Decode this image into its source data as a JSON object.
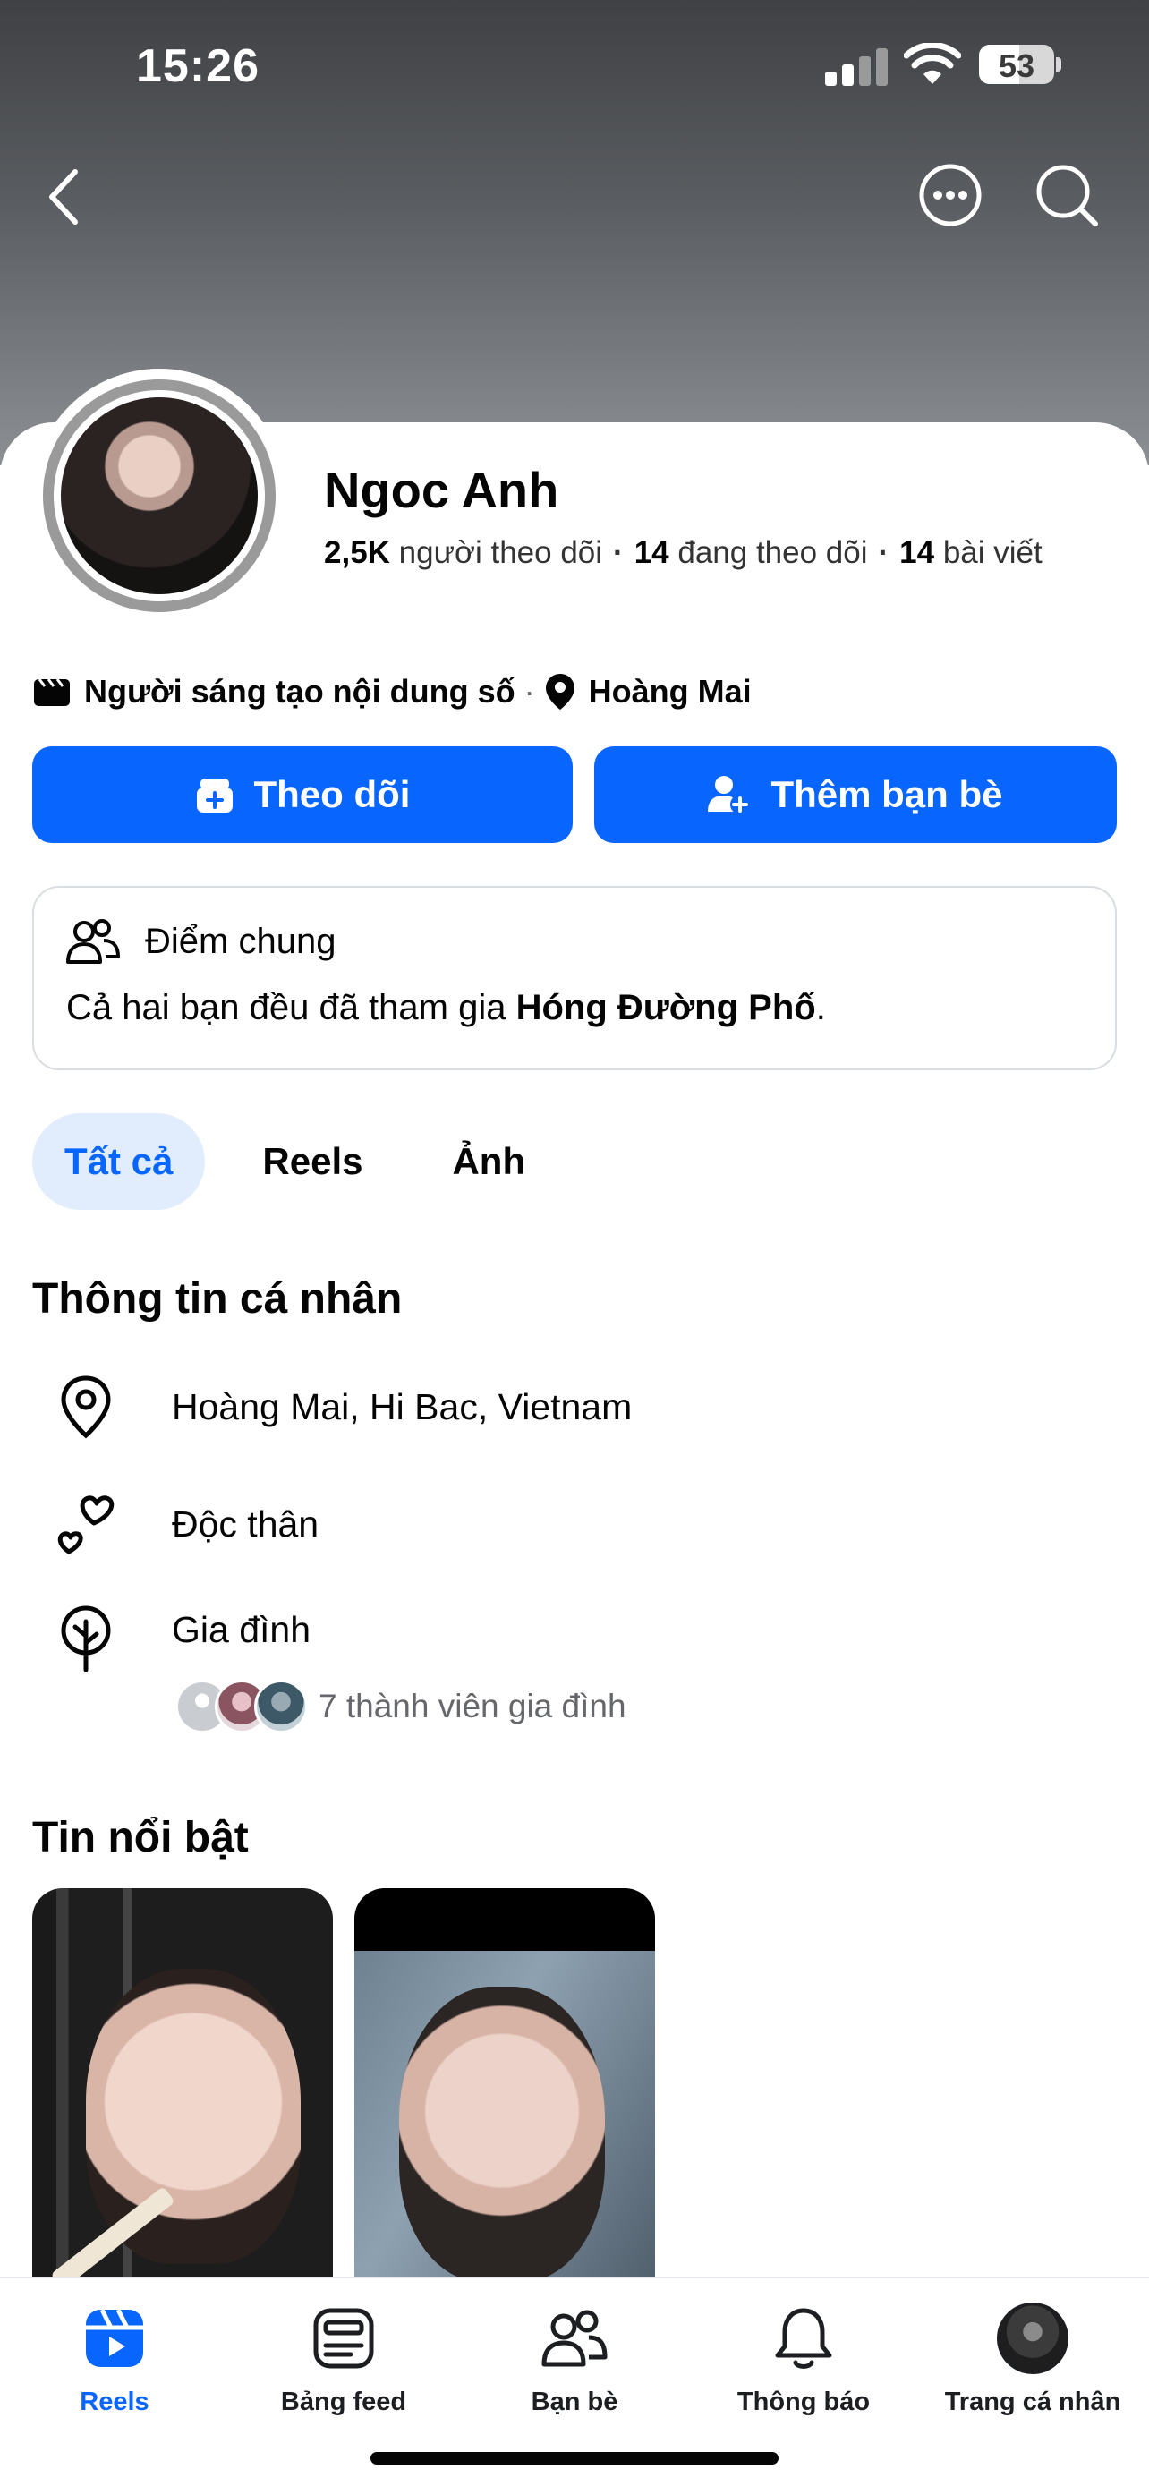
{
  "status_bar": {
    "time": "15:26",
    "battery": "53",
    "battery_level": 0.53
  },
  "profile": {
    "name": "Ngoc Anh",
    "followers_count": "2,5K",
    "followers_label": "người theo dõi",
    "following_count": "14",
    "following_label": "đang theo dõi",
    "posts_count": "14",
    "posts_label": "bài viết",
    "category": "Người sáng tạo nội dung số",
    "location": "Hoàng Mai"
  },
  "actions": {
    "follow_label": "Theo dõi",
    "add_friend_label": "Thêm bạn bè"
  },
  "common": {
    "title": "Điểm chung",
    "text_prefix": "Cả hai bạn đều đã tham gia ",
    "group_name": "Hóng Đường Phố",
    "text_suffix": "."
  },
  "tabs": [
    {
      "label": "Tất cả",
      "active": true
    },
    {
      "label": "Reels",
      "active": false
    },
    {
      "label": "Ảnh",
      "active": false
    }
  ],
  "personal_info": {
    "title": "Thông tin cá nhân",
    "location": "Hoàng Mai, Hi Bac, Vietnam",
    "relationship": "Độc thân",
    "family_title": "Gia đình",
    "family_members": "7 thành viên gia đình"
  },
  "highlights": {
    "title": "Tin nổi bật"
  },
  "bottom_nav": [
    {
      "label": "Reels",
      "icon": "reels-icon",
      "active": true
    },
    {
      "label": "Bảng feed",
      "icon": "feed-icon",
      "active": false
    },
    {
      "label": "Bạn bè",
      "icon": "friends-icon",
      "active": false
    },
    {
      "label": "Thông báo",
      "icon": "bell-icon",
      "active": false
    },
    {
      "label": "Trang cá nhân",
      "icon": "profile-avatar",
      "active": false
    }
  ],
  "colors": {
    "primary": "#0866ff",
    "tab_active_bg": "#e1edfc",
    "text": "#050505",
    "secondary": "#65676b"
  }
}
